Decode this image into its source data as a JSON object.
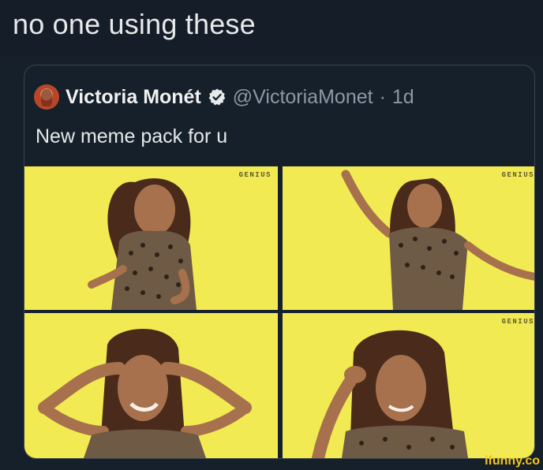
{
  "caption": "no one using these",
  "tweet": {
    "avatar_icon": "profile-photo-icon",
    "display_name": "Victoria Monét",
    "verified_icon": "verified-badge-icon",
    "handle": "@VictoriaMonet",
    "separator": "·",
    "time": "1d",
    "text": "New meme pack for u",
    "photos": [
      {
        "label": "GENIUS"
      },
      {
        "label": "GENIUS"
      },
      {
        "label": ""
      },
      {
        "label": "GENIUS"
      }
    ]
  },
  "watermark": "ifunny.co",
  "colors": {
    "background": "#15202b",
    "photo_background": "#f2ea52",
    "verified": "#1d9bf0",
    "watermark": "#f5c518"
  }
}
